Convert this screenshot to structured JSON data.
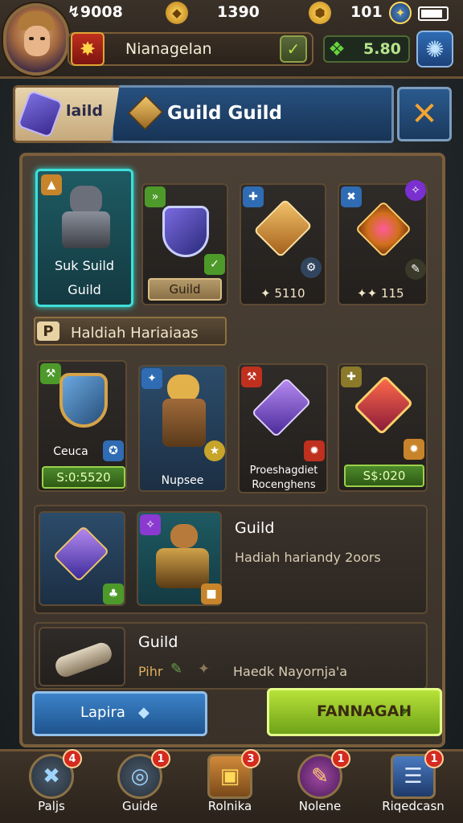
{
  "header": {
    "currency1": "↯9008",
    "currency2": "1390",
    "currency3": "101",
    "player_name": "Nianagelan",
    "gems": "5.80",
    "colors": {
      "accent_teal": "#3ee0d9",
      "gold": "#e0a637",
      "green": "#b8e23a",
      "blue": "#2b5a8e"
    }
  },
  "tabs": {
    "left_label": "laild",
    "right_label": "Guild Guild",
    "close_icon": "close-x-icon"
  },
  "top_cards": [
    {
      "title_line1": "Suk Suild",
      "title_line2": "Guild",
      "icon": "knight-icon",
      "selected": true
    },
    {
      "label": "Guild",
      "icon": "shield-icon"
    },
    {
      "price": "✦ 5110",
      "icon": "gauntlet-icon"
    },
    {
      "price": "✦✦ 115",
      "icon": "orb-icon"
    }
  ],
  "section": {
    "icon_label": "P",
    "title": "Haldiah Hariaiaas"
  },
  "mid_cards": [
    {
      "label": "Ceuca",
      "price": "S:0:5520",
      "icon": "shield-icon"
    },
    {
      "label": "Nupsee",
      "icon": "hero-icon"
    },
    {
      "label_line1": "Proeshagdiet",
      "label_line2": "Rocenghens",
      "icon": "crystal-icon"
    },
    {
      "price": "S$:020",
      "icon": "ruby-icon"
    }
  ],
  "rows": [
    {
      "title": "Guild",
      "subtitle": "Hadiah hariandy 2oors"
    },
    {
      "title": "Guild",
      "subtitle": "Haedk Nayornja'a",
      "sub_left": "Pihr"
    }
  ],
  "buttons": {
    "left_label": "Lapira",
    "right_label": "FANNAGAH"
  },
  "nav": [
    {
      "label": "Paljs",
      "badge": "4",
      "icon": "crossed-swords-icon"
    },
    {
      "label": "Guide",
      "badge": "1",
      "icon": "compass-icon"
    },
    {
      "label": "Rolnika",
      "badge": "3",
      "icon": "chest-icon"
    },
    {
      "label": "Nolene",
      "badge": "1",
      "icon": "scroll-icon"
    },
    {
      "label": "Riqedcasn",
      "badge": "1",
      "icon": "book-icon"
    }
  ]
}
